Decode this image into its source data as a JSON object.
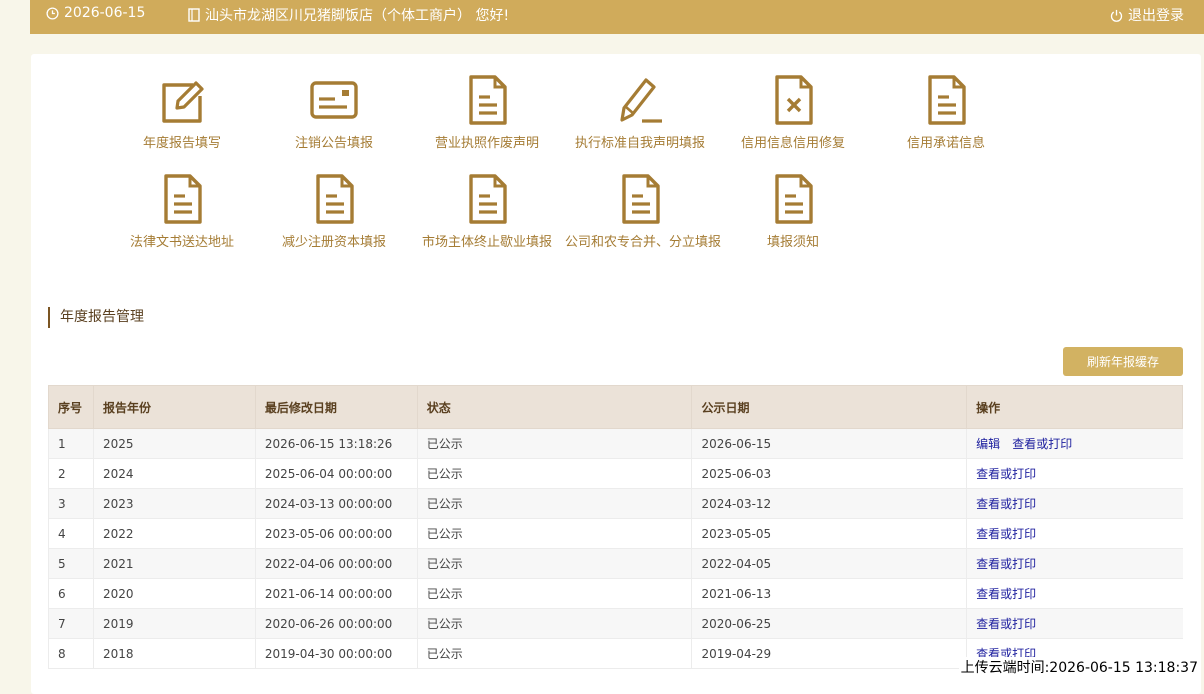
{
  "topbar": {
    "date": "2026-06-15",
    "shop_name": "汕头市龙湖区川兄猪脚饭店（个体工商户） 您好!",
    "logout_label": "退出登录"
  },
  "menu": [
    {
      "label": "年度报告填写",
      "icon": "edit-icon"
    },
    {
      "label": "注销公告填报",
      "icon": "card-icon"
    },
    {
      "label": "营业执照作废声明",
      "icon": "document-icon"
    },
    {
      "label": "执行标准自我声明填报",
      "icon": "pen-icon"
    },
    {
      "label": "信用信息信用修复",
      "icon": "document-x-icon"
    },
    {
      "label": "信用承诺信息",
      "icon": "document-icon"
    },
    {
      "label": "法律文书送达地址",
      "icon": "document-icon"
    },
    {
      "label": "减少注册资本填报",
      "icon": "document-icon"
    },
    {
      "label": "市场主体终止歇业填报",
      "icon": "document-icon"
    },
    {
      "label": "公司和农专合并、分立填报",
      "icon": "document-icon"
    },
    {
      "label": "填报须知",
      "icon": "document-icon"
    }
  ],
  "section": {
    "title": "年度报告管理",
    "refresh_label": "刷新年报缓存"
  },
  "table": {
    "headers": [
      "序号",
      "报告年份",
      "最后修改日期",
      "状态",
      "公示日期",
      "操作"
    ],
    "rows": [
      {
        "no": "1",
        "year": "2025",
        "modified": "2026-06-15 13:18:26",
        "status": "已公示",
        "published": "2026-06-15",
        "actions": [
          "编辑",
          "查看或打印"
        ]
      },
      {
        "no": "2",
        "year": "2024",
        "modified": "2025-06-04 00:00:00",
        "status": "已公示",
        "published": "2025-06-03",
        "actions": [
          "查看或打印"
        ]
      },
      {
        "no": "3",
        "year": "2023",
        "modified": "2024-03-13 00:00:00",
        "status": "已公示",
        "published": "2024-03-12",
        "actions": [
          "查看或打印"
        ]
      },
      {
        "no": "4",
        "year": "2022",
        "modified": "2023-05-06 00:00:00",
        "status": "已公示",
        "published": "2023-05-05",
        "actions": [
          "查看或打印"
        ]
      },
      {
        "no": "5",
        "year": "2021",
        "modified": "2022-04-06 00:00:00",
        "status": "已公示",
        "published": "2022-04-05",
        "actions": [
          "查看或打印"
        ]
      },
      {
        "no": "6",
        "year": "2020",
        "modified": "2021-06-14 00:00:00",
        "status": "已公示",
        "published": "2021-06-13",
        "actions": [
          "查看或打印"
        ]
      },
      {
        "no": "7",
        "year": "2019",
        "modified": "2020-06-26 00:00:00",
        "status": "已公示",
        "published": "2020-06-25",
        "actions": [
          "查看或打印"
        ]
      },
      {
        "no": "8",
        "year": "2018",
        "modified": "2019-04-30 00:00:00",
        "status": "已公示",
        "published": "2019-04-29",
        "actions": [
          "查看或打印"
        ]
      }
    ]
  },
  "upload_time": "上传云端时间:2026-06-15 13:18:37",
  "colors": {
    "brand": "#d0ab5b",
    "icon": "#a57c34",
    "link": "#1c1e9e"
  }
}
